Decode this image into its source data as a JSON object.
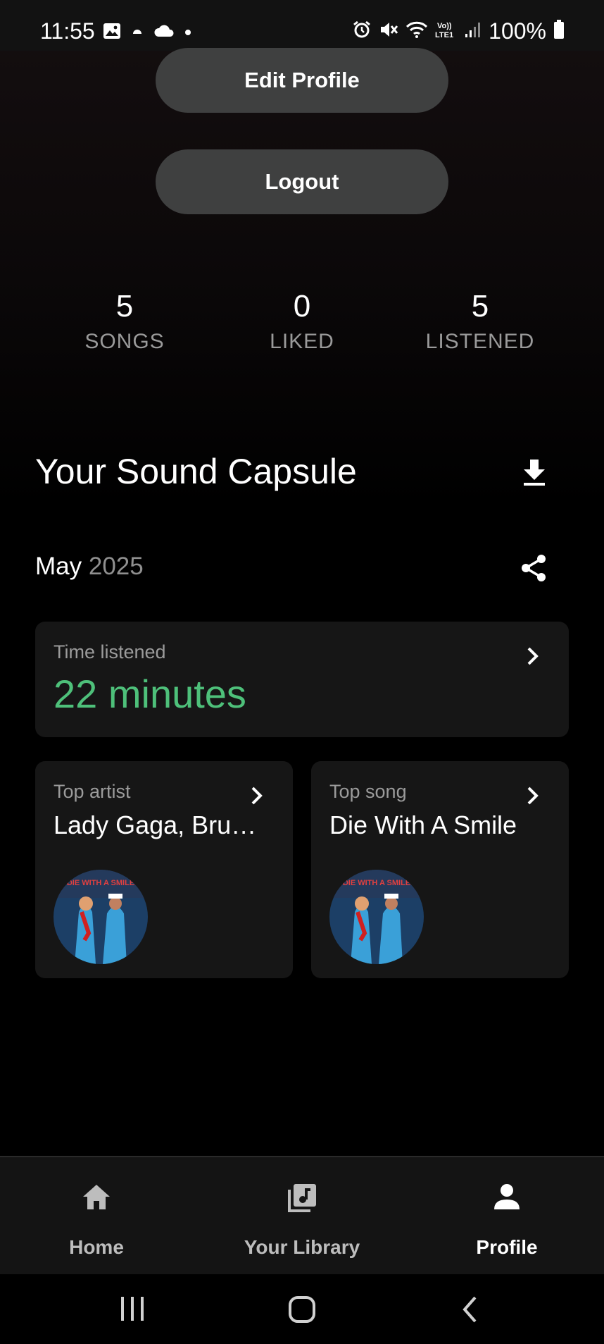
{
  "status_bar": {
    "time": "11:55",
    "battery": "100%",
    "left_icons": [
      "image-icon",
      "weather-icon",
      "cloud-icon",
      "dot-icon"
    ],
    "right_icons": [
      "alarm-icon",
      "mute-icon",
      "wifi-icon",
      "volte-icon",
      "signal-icon",
      "battery-icon"
    ]
  },
  "profile": {
    "edit_label": "Edit Profile",
    "logout_label": "Logout"
  },
  "stats": [
    {
      "value": "5",
      "label": "SONGS"
    },
    {
      "value": "0",
      "label": "LIKED"
    },
    {
      "value": "5",
      "label": "LISTENED"
    }
  ],
  "capsule": {
    "title": "Your Sound Capsule",
    "month": "May",
    "year": "2025",
    "time_label": "Time listened",
    "time_value": "22 minutes",
    "artist_label": "Top artist",
    "artist_value": "Lady Gaga, Bruno Mars",
    "song_label": "Top song",
    "song_value": "Die With A Smile"
  },
  "bottom_nav": {
    "items": [
      {
        "label": "Home",
        "icon": "home-icon"
      },
      {
        "label": "Your Library",
        "icon": "library-icon"
      },
      {
        "label": "Profile",
        "icon": "profile-icon",
        "active": true
      }
    ]
  },
  "colors": {
    "accent": "#4ec07a",
    "button_bg": "#3f4040",
    "card_bg": "#161616"
  }
}
